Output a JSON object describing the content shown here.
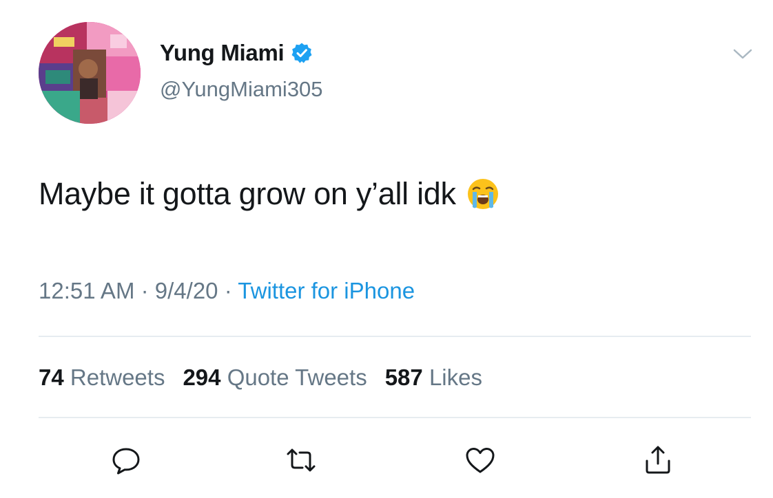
{
  "user": {
    "display_name": "Yung Miami",
    "handle": "@YungMiami305",
    "verified": true,
    "avatar_icon": "profile-photo-collage"
  },
  "tweet": {
    "text": "Maybe it gotta grow on y’all idk",
    "emoji": "loudly-crying-face",
    "time": "12:51 AM",
    "date": "9/4/20",
    "separator": "·",
    "source": "Twitter for iPhone"
  },
  "stats": {
    "retweets_count": "74",
    "retweets_label": "Retweets",
    "quote_count": "294",
    "quote_label": "Quote Tweets",
    "likes_count": "587",
    "likes_label": "Likes"
  },
  "actions": {
    "reply_icon": "reply-icon",
    "retweet_icon": "retweet-icon",
    "like_icon": "heart-icon",
    "share_icon": "share-icon"
  },
  "colors": {
    "text_primary": "#14171a",
    "text_secondary": "#657786",
    "link": "#1b95e0",
    "verified_badge": "#1da1f2",
    "divider": "#e6ecf0"
  }
}
